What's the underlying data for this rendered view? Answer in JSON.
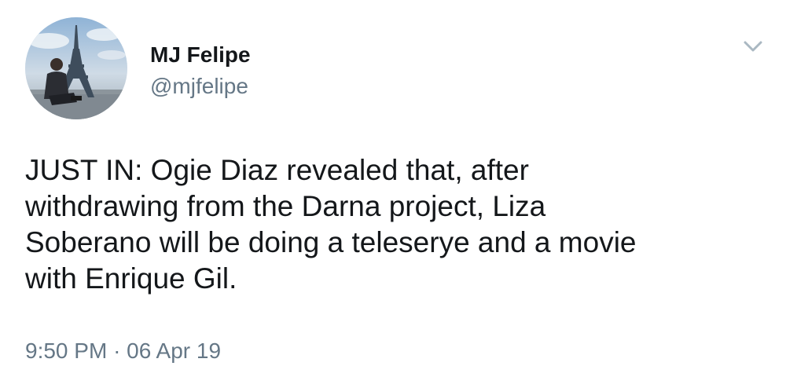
{
  "tweet": {
    "author": {
      "display_name": "MJ Felipe",
      "handle": "@mjfelipe",
      "avatar_icon": "profile-photo-eiffel-tower"
    },
    "text": "JUST IN: Ogie Diaz revealed that, after\nwithdrawing from the Darna project, Liza\nSoberano will be doing a teleserye and a movie\nwith Enrique Gil.",
    "time": "9:50 PM",
    "separator": "·",
    "date": "06 Apr 19",
    "menu_icon": "chevron-down-icon"
  },
  "colors": {
    "text_primary": "#14171a",
    "text_secondary": "#657786",
    "chevron": "#aab8c2",
    "background": "#ffffff"
  }
}
